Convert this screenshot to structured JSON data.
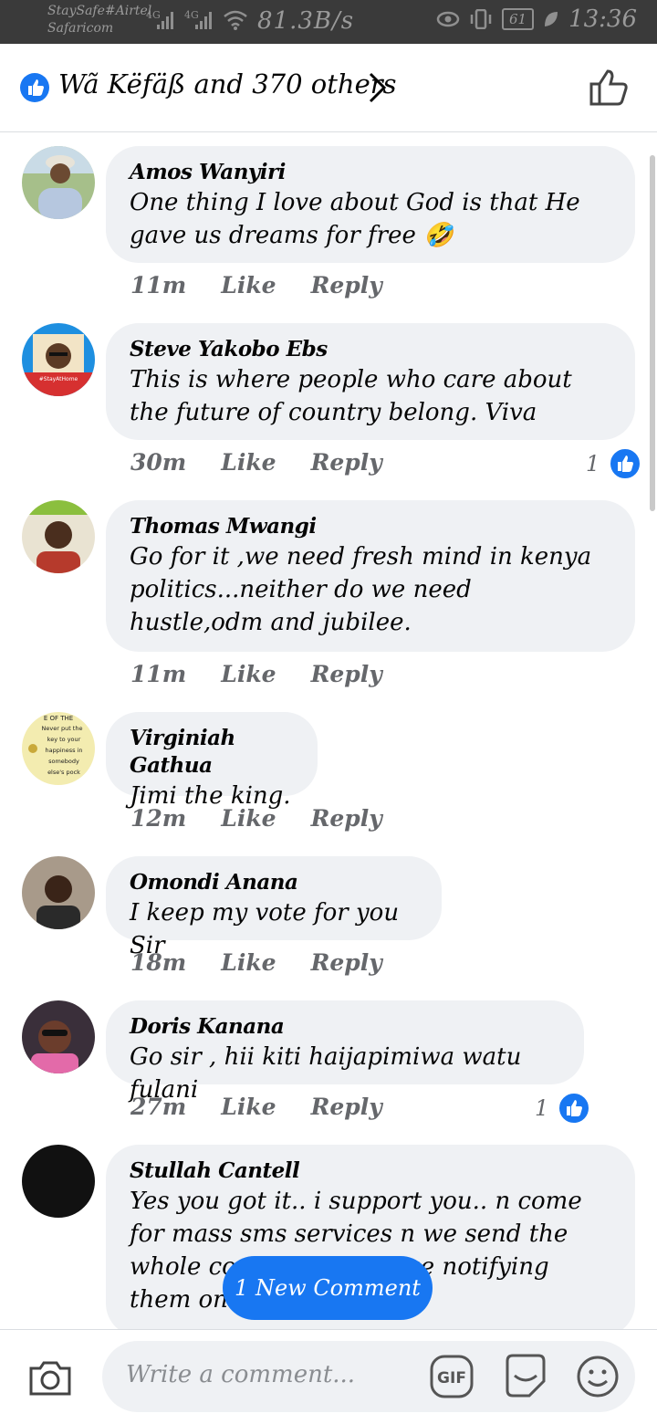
{
  "status_bar": {
    "carrier1": "StaySafe#Airtel",
    "carrier2": "Safaricom",
    "sig1": "4G",
    "sig2": "4G",
    "speed": "81.3B/s",
    "battery": "61",
    "time": "13:36"
  },
  "header": {
    "reactors_text": "Wã Këfäß and 370 others"
  },
  "comments": [
    {
      "name": "Amos Wanyiri",
      "text": "One thing I love about God is that He gave us dreams for free 🤣",
      "time": "11m",
      "like": "Like",
      "reply": "Reply",
      "reactions": ""
    },
    {
      "name": "Steve Yakobo Ebs",
      "text": "This is where people who care about the future of country belong. Viva",
      "time": "30m",
      "like": "Like",
      "reply": "Reply",
      "reactions": "1"
    },
    {
      "name": "Thomas Mwangi",
      "text": "Go for it ,we need fresh mind in kenya politics...neither do we need  hustle,odm and jubilee.",
      "time": "11m",
      "like": "Like",
      "reply": "Reply",
      "reactions": ""
    },
    {
      "name": "Virginiah Gathua",
      "text": "Jimi the king.",
      "time": "12m",
      "like": "Like",
      "reply": "Reply",
      "reactions": ""
    },
    {
      "name": "Omondi Anana",
      "text": "I keep my vote for you Sir",
      "time": "18m",
      "like": "Like",
      "reply": "Reply",
      "reactions": ""
    },
    {
      "name": "Doris Kanana",
      "text": "Go sir , hii kiti haijapimiwa watu fulani",
      "time": "27m",
      "like": "Like",
      "reply": "Reply",
      "reactions": "1"
    },
    {
      "name": "Stullah Cantell",
      "text": "Yes you got it.. i support you.. n come for mass sms services n we send the whole country a message notifying them on anything...",
      "time": "",
      "like": "",
      "reply": "",
      "reactions": ""
    }
  ],
  "avatar3_text": [
    "E OF THE",
    "Never put the",
    "key to your",
    "happiness in",
    "somebody",
    "else's pock"
  ],
  "avatar2_badge": "#StayAtHome",
  "new_comment_label": "1 New Comment",
  "composer": {
    "placeholder": "Write a comment...",
    "gif_label": "GIF"
  },
  "colors": {
    "accent": "#1877f2",
    "bubble": "#eff1f4",
    "meta": "#65676b"
  }
}
